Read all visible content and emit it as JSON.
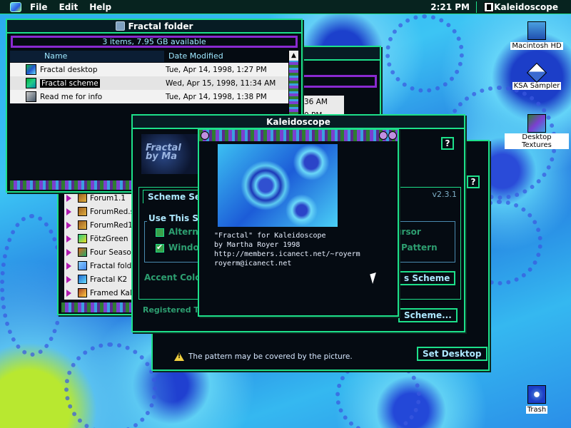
{
  "menubar": {
    "menus": [
      "File",
      "Edit",
      "Help"
    ],
    "clock": "2:21 PM",
    "app_name": "Kaleidoscope"
  },
  "folder_window": {
    "title": "Fractal folder",
    "status": "3 items, 7.95 GB available",
    "columns": {
      "name": "Name",
      "date": "Date Modified"
    },
    "items": [
      {
        "name": "Fractal desktop",
        "date": "Tue, Apr 14, 1998, 1:27 PM"
      },
      {
        "name": "Fractal scheme",
        "date": "Wed, Apr 15, 1998, 11:34 AM"
      },
      {
        "name": "Read me for info",
        "date": "Tue, Apr 14, 1998, 1:38 PM"
      }
    ]
  },
  "bg_list": {
    "items": [
      "Forum1.1",
      "ForumRed.s",
      "ForumRed1.",
      "FötzGreen",
      "Four Season",
      "Fractal fold",
      "Fractal K2",
      "Framed Kale"
    ],
    "times": [
      "36 AM",
      "0 PM"
    ]
  },
  "kaleidoscope": {
    "title": "Kaleidoscope",
    "logo_text": "Fractal by Ma",
    "tab_label": "Scheme Set",
    "version": "v2.3.1",
    "group_label": "Use This Sc",
    "checkbox_1": "Alterna",
    "checkbox_2": "Window",
    "right_1": "ursor",
    "right_2": "Pattern",
    "accent_label": "Accent Colo",
    "registered_label": "Registered To",
    "btn_scheme": "s Scheme",
    "btn_scheme2": "Scheme...",
    "help": "?"
  },
  "lower_window": {
    "warning": "The pattern may be covered by the picture.",
    "set_desktop": "Set Desktop"
  },
  "about": {
    "lines": [
      "\"Fractal\" for Kaleidoscope",
      "by Martha Royer 1998",
      "http://members.icanect.net/~royerm",
      "royerm@icanect.net"
    ]
  },
  "desktop_icons": {
    "hd": "Macintosh HD",
    "ksa": "KSA Sampler",
    "textures": "Desktop Textures",
    "trash": "Trash"
  },
  "colors": {
    "accent": "#1de08a",
    "frame": "#8a2ad0",
    "menubar": "#07231f"
  }
}
